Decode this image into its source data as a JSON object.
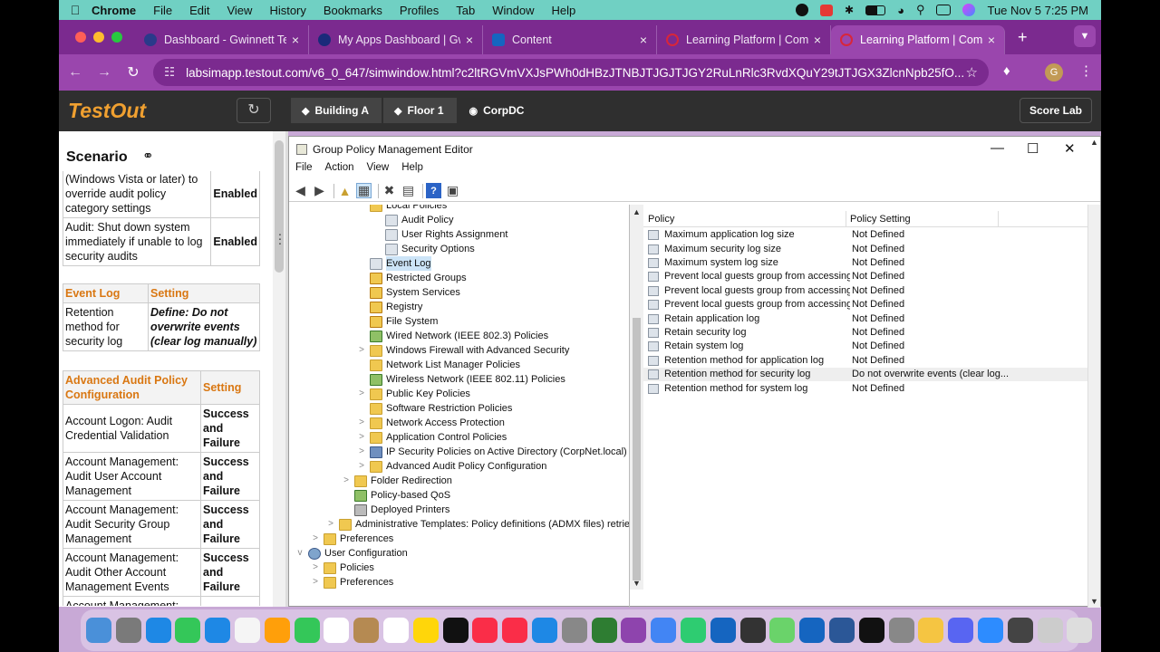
{
  "menubar": {
    "app": "Chrome",
    "items": [
      "File",
      "Edit",
      "View",
      "History",
      "Bookmarks",
      "Profiles",
      "Tab",
      "Window",
      "Help"
    ],
    "clock": "Tue Nov 5  7:25 PM"
  },
  "tabs": [
    {
      "title": "Dashboard - Gwinnett Te",
      "color": "#2a3a8a"
    },
    {
      "title": "My Apps Dashboard | Gw",
      "color": "#1a2a7a"
    },
    {
      "title": "Content",
      "color": "#1565c0"
    },
    {
      "title": "Learning Platform | Comp",
      "color": "#d8263a"
    },
    {
      "title": "Learning Platform | Comp",
      "color": "#d8263a"
    }
  ],
  "address": {
    "url": "labsimapp.testout.com/v6_0_647/simwindow.html?c2ltRGVmVXJsPWh0dHBzJTNBJTJGJTJGY2RuLnRlc3RvdXQuY29tJTJGX3ZlcnNpb25fO...",
    "profile_initial": "G"
  },
  "testout": {
    "logo": "TestOut",
    "crumbs": [
      "Building A",
      "Floor 1",
      "CorpDC"
    ],
    "score_button": "Score Lab"
  },
  "scenario": {
    "title": "Scenario",
    "table1": [
      {
        "policy": "(Windows Vista or later) to override audit policy category settings",
        "setting": "Enabled"
      },
      {
        "policy": "Audit: Shut down system immediately if unable to log security audits",
        "setting": "Enabled"
      }
    ],
    "table2": {
      "headers": [
        "Event Log",
        "Setting"
      ],
      "rows": [
        {
          "policy": "Retention method for security log",
          "setting": "Define: Do not overwrite events (clear log manually)"
        }
      ]
    },
    "table3": {
      "headers": [
        "Advanced Audit Policy Configuration",
        "Setting"
      ],
      "rows": [
        {
          "policy": "Account Logon: Audit Credential Validation",
          "setting": "Success and Failure"
        },
        {
          "policy": "Account Management: Audit User Account Management",
          "setting": "Success and Failure"
        },
        {
          "policy": "Account Management: Audit Security Group Management",
          "setting": "Success and Failure"
        },
        {
          "policy": "Account Management: Audit Other Account Management Events",
          "setting": "Success and Failure"
        },
        {
          "policy": "Account Management:",
          "setting": ""
        }
      ]
    }
  },
  "gpme": {
    "title": "Group Policy Management Editor",
    "menu": [
      "File",
      "Action",
      "View",
      "Help"
    ],
    "tree": [
      {
        "label": "Local Policies",
        "level": 5,
        "icon": "folder",
        "exp": ""
      },
      {
        "label": "Audit Policy",
        "level": 6,
        "icon": "doc",
        "exp": ""
      },
      {
        "label": "User Rights Assignment",
        "level": 6,
        "icon": "doc",
        "exp": ""
      },
      {
        "label": "Security Options",
        "level": 6,
        "icon": "doc",
        "exp": ""
      },
      {
        "label": "Event Log",
        "level": 5,
        "icon": "doc",
        "exp": "",
        "selected": true
      },
      {
        "label": "Restricted Groups",
        "level": 5,
        "icon": "lock",
        "exp": ""
      },
      {
        "label": "System Services",
        "level": 5,
        "icon": "lock",
        "exp": ""
      },
      {
        "label": "Registry",
        "level": 5,
        "icon": "lock",
        "exp": ""
      },
      {
        "label": "File System",
        "level": 5,
        "icon": "lock",
        "exp": ""
      },
      {
        "label": "Wired Network (IEEE 802.3) Policies",
        "level": 5,
        "icon": "chart",
        "exp": ""
      },
      {
        "label": "Windows Firewall with Advanced Security",
        "level": 5,
        "icon": "folder",
        "exp": ">"
      },
      {
        "label": "Network List Manager Policies",
        "level": 5,
        "icon": "folder",
        "exp": ""
      },
      {
        "label": "Wireless Network (IEEE 802.11) Policies",
        "level": 5,
        "icon": "chart",
        "exp": ""
      },
      {
        "label": "Public Key Policies",
        "level": 5,
        "icon": "folder",
        "exp": ">"
      },
      {
        "label": "Software Restriction Policies",
        "level": 5,
        "icon": "folder",
        "exp": ""
      },
      {
        "label": "Network Access Protection",
        "level": 5,
        "icon": "folder",
        "exp": ">"
      },
      {
        "label": "Application Control Policies",
        "level": 5,
        "icon": "folder",
        "exp": ">"
      },
      {
        "label": "IP Security Policies on Active Directory (CorpNet.local)",
        "level": 5,
        "icon": "pc",
        "exp": ">"
      },
      {
        "label": "Advanced Audit Policy Configuration",
        "level": 5,
        "icon": "folder",
        "exp": ">"
      },
      {
        "label": "Folder Redirection",
        "level": 4,
        "icon": "folder",
        "exp": ">"
      },
      {
        "label": "Policy-based QoS",
        "level": 4,
        "icon": "chart",
        "exp": ""
      },
      {
        "label": "Deployed Printers",
        "level": 4,
        "icon": "printer",
        "exp": ""
      },
      {
        "label": "Administrative Templates: Policy definitions (ADMX files) retrieved",
        "level": 3,
        "icon": "folder",
        "exp": ">"
      },
      {
        "label": "Preferences",
        "level": 2,
        "icon": "folder",
        "exp": ">"
      },
      {
        "label": "User Configuration",
        "level": 1,
        "icon": "user",
        "exp": "v"
      },
      {
        "label": "Policies",
        "level": 2,
        "icon": "folder",
        "exp": ">"
      },
      {
        "label": "Preferences",
        "level": 2,
        "icon": "folder",
        "exp": ">"
      }
    ],
    "list_headers": [
      "Policy",
      "Policy Setting"
    ],
    "list": [
      {
        "policy": "Maximum application log size",
        "setting": "Not Defined"
      },
      {
        "policy": "Maximum security log size",
        "setting": "Not Defined"
      },
      {
        "policy": "Maximum system log size",
        "setting": "Not Defined"
      },
      {
        "policy": "Prevent local guests group from accessing a",
        "setting": "Not Defined"
      },
      {
        "policy": "Prevent local guests group from accessing s",
        "setting": "Not Defined"
      },
      {
        "policy": "Prevent local guests group from accessing s",
        "setting": "Not Defined"
      },
      {
        "policy": "Retain application log",
        "setting": "Not Defined"
      },
      {
        "policy": "Retain security log",
        "setting": "Not Defined"
      },
      {
        "policy": "Retain system log",
        "setting": "Not Defined"
      },
      {
        "policy": "Retention method for application log",
        "setting": "Not Defined"
      },
      {
        "policy": "Retention method for security log",
        "setting": "Do not overwrite events (clear log...",
        "highlight": true
      },
      {
        "policy": "Retention method for system log",
        "setting": "Not Defined"
      }
    ]
  },
  "dock_colors": [
    "#4a90d9",
    "#7a7a7a",
    "#1e88e5",
    "#34c759",
    "#1e88e5",
    "#f5f5f5",
    "#ff9f0a",
    "#34c759",
    "#ffffff",
    "#b58a52",
    "#ffffff",
    "#ffd60a",
    "#111111",
    "#fa2d48",
    "#fa2d48",
    "#1e88e5",
    "#888888",
    "#2e7d32",
    "#8e44ad",
    "#4285f4",
    "#2ecc71",
    "#1565c0",
    "#333333",
    "#6ad36a",
    "#1565c0",
    "#2b5797",
    "#111111",
    "#888888",
    "#f5c542",
    "#5865f2",
    "#2d8cff",
    "#444444",
    "#cccccc",
    "#dddddd"
  ]
}
